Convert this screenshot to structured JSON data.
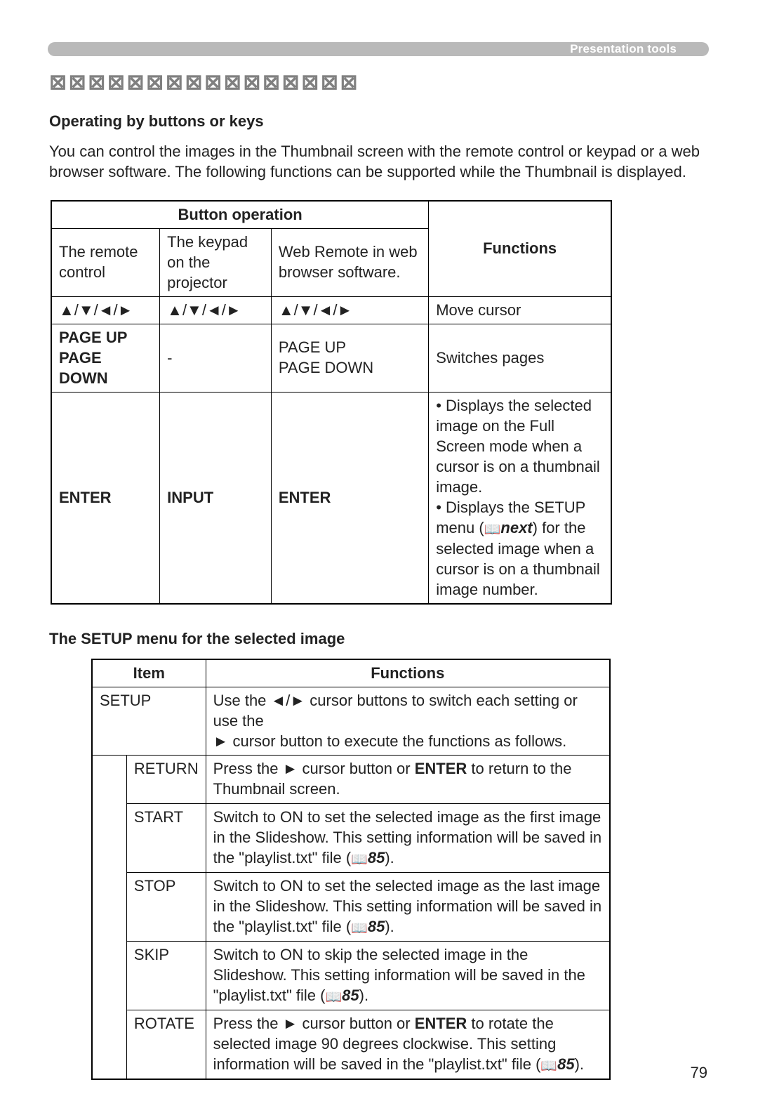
{
  "header": {
    "chip": "Presentation tools"
  },
  "title_xx": "⊠⊠⊠⊠⊠⊠⊠⊠⊠⊠⊠⊠⊠⊠⊠⊠",
  "subhead1": "Operating by buttons or keys",
  "intro": "You can control the images in the Thumbnail screen with the remote control or keypad or a web browser software. The following functions can be supported while the Thumbnail is displayed.",
  "table1": {
    "head_button_op": "Button operation",
    "head_remote": "The remote control",
    "head_keypad": "The keypad on the projector",
    "head_web": "Web Remote in web browser software.",
    "head_functions": "Functions",
    "arrow_group": "▲/▼/◄/►",
    "row_cursor_fn": "Move cursor",
    "row_page_remote": "PAGE UP\nPAGE DOWN",
    "row_page_keypad": "-",
    "row_page_web": "PAGE UP\nPAGE DOWN",
    "row_page_fn": "Switches pages",
    "row_enter_remote": "ENTER",
    "row_enter_keypad": "INPUT",
    "row_enter_web": "ENTER",
    "row_enter_fn_1": "• Displays the selected image on the Full Screen mode when a cursor is on a thumbnail image.",
    "row_enter_fn_2a": "• Displays the SETUP menu (",
    "row_enter_fn_ref": "next",
    "row_enter_fn_2b": ") for the selected image when a cursor is on a thumbnail image number."
  },
  "subhead2": "The SETUP menu for the selected image",
  "table2": {
    "head_item": "Item",
    "head_functions": "Functions",
    "row_setup_item": "SETUP",
    "row_setup_fn_a": "Use the ◄/► cursor buttons to switch each setting or use the ",
    "row_setup_fn_b": "► cursor button to execute the functions as follows.",
    "row_return_item": "RETURN",
    "row_return_fn_a": "Press the ► cursor button or ",
    "row_return_fn_b": "ENTER",
    "row_return_fn_c": " to return to the Thumbnail screen.",
    "row_start_item": "START",
    "row_start_fn_a": "Switch to ON to set the selected image as the first image in the Slideshow. This setting information will be saved in the \"playlist.txt\" file (",
    "row_start_ref": "85",
    "row_start_fn_b": ").",
    "row_stop_item": "STOP",
    "row_stop_fn_a": "Switch to ON to set the selected image as the last image in the Slideshow. This setting information will be saved in the \"playlist.txt\" file (",
    "row_stop_ref": "85",
    "row_stop_fn_b": ").",
    "row_skip_item": "SKIP",
    "row_skip_fn_a": "Switch to ON to skip the selected image in the Slideshow. This setting information will be saved in the \"playlist.txt\" file (",
    "row_skip_ref": "85",
    "row_skip_fn_b": ").",
    "row_rotate_item": "ROTATE",
    "row_rotate_fn_a": "Press the ► cursor button or ",
    "row_rotate_fn_b": "ENTER",
    "row_rotate_fn_c": " to rotate the selected image 90 degrees clockwise. This setting information will be saved in the \"playlist.txt\" file (",
    "row_rotate_ref": "85",
    "row_rotate_fn_d": ")."
  },
  "icons": {
    "book": "📖"
  },
  "page_number": "79"
}
